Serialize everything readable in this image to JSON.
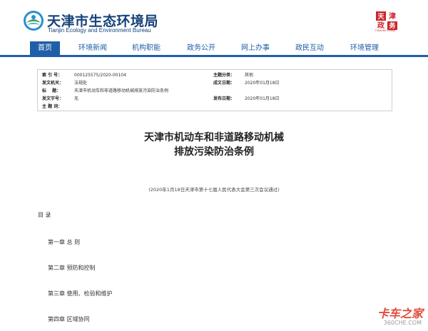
{
  "site": {
    "title": "天津市生态环境局",
    "subtitle": "Tianjin Ecology and Environment Bureau",
    "emblem_text": "天津 政务",
    "emblem_sub": "TIANJIN CHINA"
  },
  "nav": {
    "items": [
      {
        "label": "首页"
      },
      {
        "label": "环境新闻"
      },
      {
        "label": "机构职能"
      },
      {
        "label": "政务公开"
      },
      {
        "label": "网上办事"
      },
      {
        "label": "政民互动"
      },
      {
        "label": "环境管理"
      }
    ]
  },
  "meta": {
    "index_no_label": "索 引 号：",
    "index_no": "000125575/2020-00104",
    "category_label": "主题分类：",
    "category": "其他",
    "issuer_label": "发文机关：",
    "issuer": "法规处",
    "created_label": "成文日期：",
    "created": "2020年01月18日",
    "title_label": "标　 题：",
    "title": "天津市机动车和非道路移动机械排放污染防治条例",
    "doc_no_label": "发文字号：",
    "doc_no": "无",
    "published_label": "发布日期：",
    "published": "2020年01月18日",
    "keywords_label": "主 题 词："
  },
  "document": {
    "title_line1": "天津市机动车和非道路移动机械",
    "title_line2": "排放污染防治条例",
    "subtitle": "(2020年1月18日天津市第十七届人民代表大会第三次会议通过)",
    "toc_heading": "目 录",
    "toc": [
      {
        "label": "第一章 总 则"
      },
      {
        "label": "第二章 预防和控制"
      },
      {
        "label": "第三章 使用、检验和维护"
      },
      {
        "label": "第四章 区域协同"
      }
    ]
  },
  "watermark": {
    "main": "卡车之家",
    "sub": "360CHE.COM"
  },
  "colors": {
    "nav_blue": "#1f5fa9",
    "title_blue": "#16427a",
    "emblem_red": "#c8282d"
  }
}
